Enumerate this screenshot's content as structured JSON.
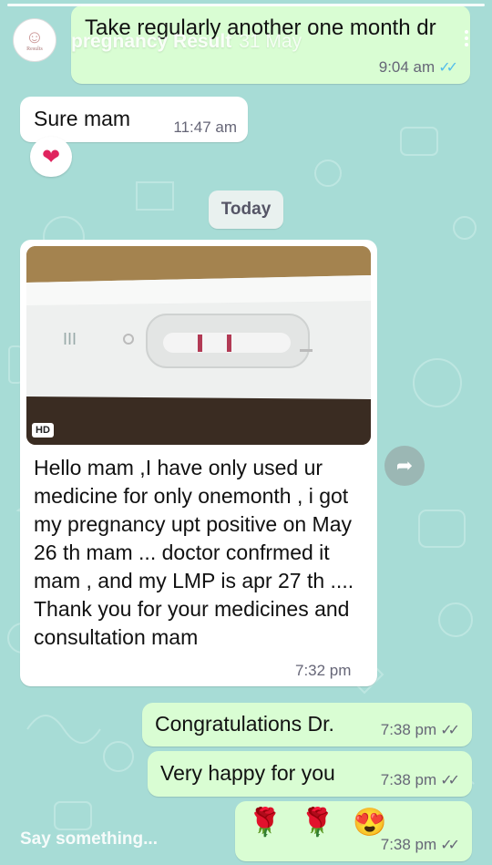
{
  "story": {
    "title": "pregnancy Result",
    "date": "31 May",
    "avatar_label": "Results",
    "reply_placeholder": "Say something..."
  },
  "messages": [
    {
      "text": "Take regularly another one month dr",
      "time": "9:04 am",
      "direction": "out",
      "ticks": "read"
    },
    {
      "text": "Sure mam",
      "time": "11:47 am",
      "direction": "in"
    },
    {
      "text": "Hello mam ,I have only used ur medicine for only onemonth , i got my pregnancy upt positive on May 26 th mam ...  doctor confrmed it mam , and my LMP is apr 27 th .... Thank you for your medicines and consultation mam",
      "time": "7:32 pm",
      "direction": "in",
      "has_photo": true
    },
    {
      "text": "Congratulations Dr.",
      "time": "7:38 pm",
      "direction": "out",
      "ticks": "delivered"
    },
    {
      "text": "Very happy for you",
      "time": "7:38 pm",
      "direction": "out",
      "ticks": "delivered"
    },
    {
      "text": "🌹 🌹 😍",
      "time": "7:38 pm",
      "direction": "out",
      "ticks": "delivered"
    }
  ],
  "reaction": "❤",
  "date_divider": "Today",
  "photo_badge": "HD",
  "icons": {
    "more": "more-vertical-icon",
    "forward": "forward-icon",
    "read_ticks": "✓✓",
    "delivered_ticks": "✓✓"
  },
  "colors": {
    "background": "#a7dcd6",
    "outgoing_bubble": "#d9fdd3",
    "incoming_bubble": "#ffffff",
    "read_tick": "#53bdeb"
  }
}
